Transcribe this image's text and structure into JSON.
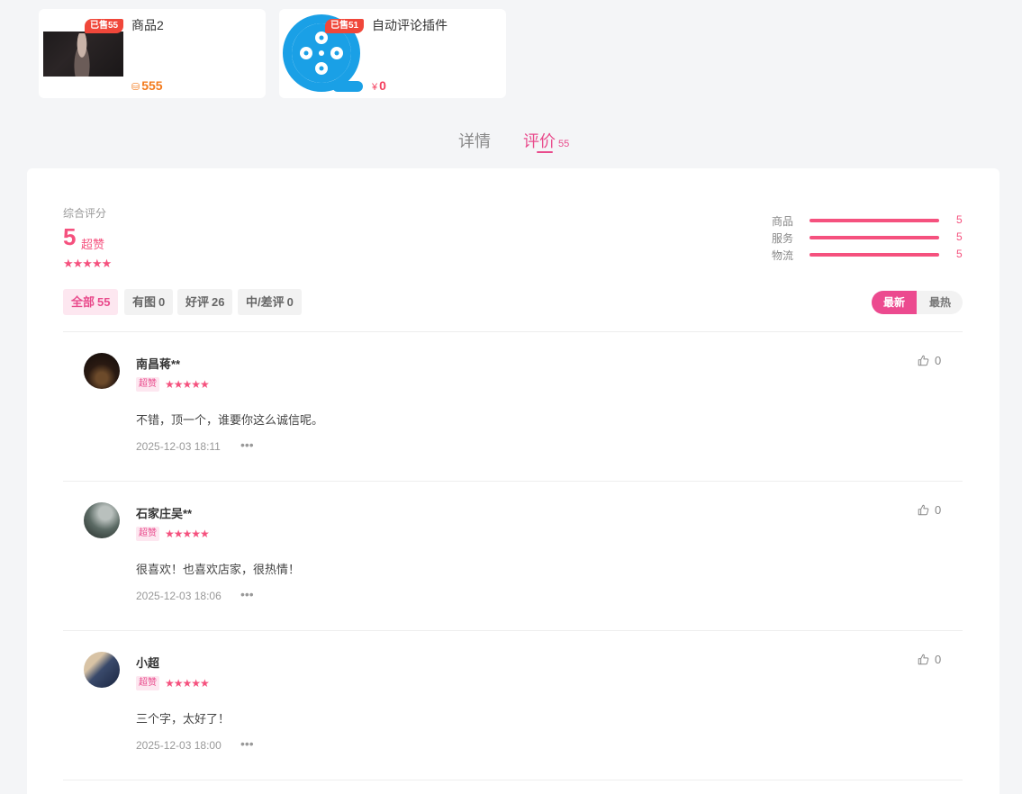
{
  "products": [
    {
      "name": "商品2",
      "sold_badge": "已售55",
      "currency": "⛁",
      "price": "555",
      "image_icon": "photo-thumbnail-icon"
    },
    {
      "name": "自动评论插件",
      "sold_badge": "已售51",
      "currency": "¥",
      "price": "0",
      "image_icon": "film-reel-logo-icon"
    }
  ],
  "tabs": {
    "detail": "详情",
    "review": "评价",
    "review_count": "55"
  },
  "summary": {
    "label": "综合评分",
    "score": "5",
    "word": "超赞",
    "stars": "★★★★★",
    "metrics": [
      {
        "label": "商品",
        "value": "5",
        "fill": 1.0
      },
      {
        "label": "服务",
        "value": "5",
        "fill": 1.0
      },
      {
        "label": "物流",
        "value": "5",
        "fill": 1.0
      }
    ]
  },
  "filters": [
    {
      "label": "全部",
      "count": "55",
      "active": true
    },
    {
      "label": "有图",
      "count": "0",
      "active": false
    },
    {
      "label": "好评",
      "count": "26",
      "active": false
    },
    {
      "label": "中/差评",
      "count": "0",
      "active": false
    }
  ],
  "sort": {
    "newest": "最新",
    "hottest": "最热",
    "selected": "最新"
  },
  "reviews": [
    {
      "user": "南昌蒋**",
      "badge": "超赞",
      "stars": "★★★★★",
      "text": "不错，顶一个，谁要你这么诚信呢。",
      "time": "2025-12-03 18:11",
      "more": "•••",
      "likes": "0"
    },
    {
      "user": "石家庄吴**",
      "badge": "超赞",
      "stars": "★★★★★",
      "text": "很喜欢！也喜欢店家，很热情！",
      "time": "2025-12-03 18:06",
      "more": "•••",
      "likes": "0"
    },
    {
      "user": "小超",
      "badge": "超赞",
      "stars": "★★★★★",
      "text": "三个字，太好了！",
      "time": "2025-12-03 18:00",
      "more": "•••",
      "likes": "0"
    }
  ],
  "colors": {
    "accent": "#e94b8c",
    "star": "#f5517e",
    "sold_badge": "#f0473a",
    "price_orange": "#f37b1d",
    "logo_blue": "#1aa0e6"
  }
}
